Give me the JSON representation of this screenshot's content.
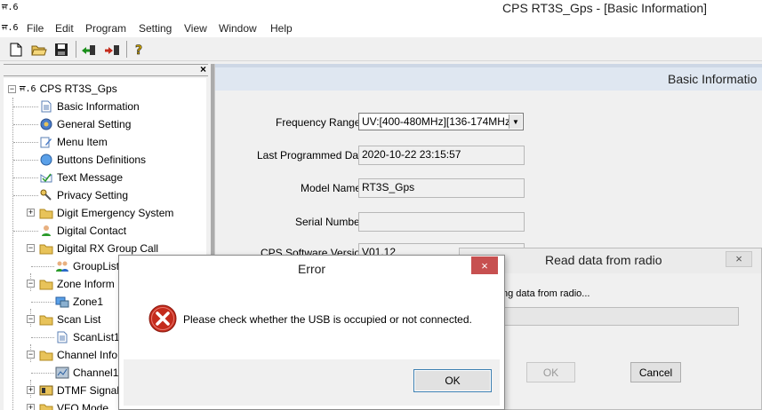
{
  "window": {
    "app_icon": "ਜ.6",
    "title": "CPS RT3S_Gps - [Basic Information]"
  },
  "menu": {
    "items": [
      "File",
      "Edit",
      "Program",
      "Setting",
      "View",
      "Window",
      "Help"
    ]
  },
  "toolbar": {
    "icons": [
      "new-file-icon",
      "open-folder-icon",
      "save-icon",
      "read-from-radio-icon",
      "write-to-radio-icon",
      "help-icon"
    ]
  },
  "tree": {
    "close_glyph": "×",
    "root": {
      "prefix": "ਜ.6",
      "label": "CPS RT3S_Gps"
    },
    "items": [
      {
        "label": "Basic Information",
        "icon": "document-icon"
      },
      {
        "label": "General Setting",
        "icon": "gear-icon"
      },
      {
        "label": "Menu Item",
        "icon": "edit-icon"
      },
      {
        "label": "Buttons Definitions",
        "icon": "circle-button-icon"
      },
      {
        "label": "Text Message",
        "icon": "message-icon"
      },
      {
        "label": "Privacy Setting",
        "icon": "key-icon"
      },
      {
        "label": "Digit Emergency System",
        "icon": "folder-icon"
      },
      {
        "label": "Digital Contact",
        "icon": "contact-icon"
      },
      {
        "label": "Digital RX Group Call",
        "icon": "folder-icon"
      },
      {
        "label": "GroupList",
        "icon": "group-icon"
      },
      {
        "label": "Zone Inform",
        "icon": "folder-icon"
      },
      {
        "label": "Zone1",
        "icon": "zone-icon"
      },
      {
        "label": "Scan List",
        "icon": "folder-icon"
      },
      {
        "label": "ScanList1",
        "icon": "document-icon"
      },
      {
        "label": "Channel Info",
        "icon": "folder-icon"
      },
      {
        "label": "Channel1",
        "icon": "channel-icon"
      },
      {
        "label": "DTMF Signal",
        "icon": "dtmf-icon"
      },
      {
        "label": "VFO Mode",
        "icon": "folder-icon"
      }
    ]
  },
  "basic_info": {
    "title": "Basic Informatio",
    "frequency_range_label": "Frequency Range",
    "frequency_range_value": "UV:[400-480MHz][136-174MHz]",
    "last_programmed_label": "Last Programmed Date",
    "last_programmed_value": "2020-10-22 23:15:57",
    "model_name_label": "Model Name",
    "model_name_value": "RT3S_Gps",
    "serial_number_label": "Serial Number",
    "serial_number_value": "",
    "cps_version_label": "CPS Software Version",
    "cps_version_value": "V01.12"
  },
  "read_dialog": {
    "title": "Read data from radio",
    "close_glyph": "×",
    "message": "ng data from radio...",
    "ok_label": "OK",
    "cancel_label": "Cancel"
  },
  "error_dialog": {
    "title": "Error",
    "close_glyph": "×",
    "message": "Please check whether the USB is occupied or not connected.",
    "ok_label": "OK"
  },
  "colors": {
    "error_red": "#c42b1c",
    "close_red": "#c75050",
    "folder_yellow": "#e8c35a"
  }
}
